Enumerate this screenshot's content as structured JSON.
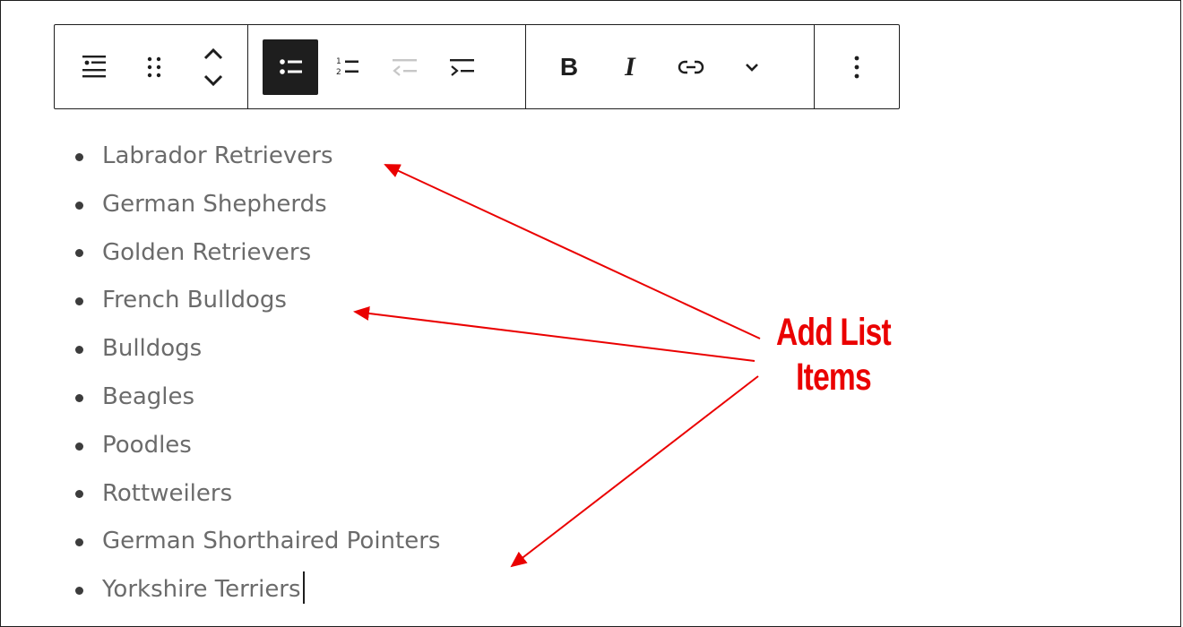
{
  "toolbar": {
    "groups": [
      {
        "name": "block-tools",
        "buttons": [
          {
            "icon": "list-block-icon",
            "active": false
          },
          {
            "icon": "drag-handle-icon",
            "active": false
          },
          {
            "icon": "move-up-down-icon",
            "active": false
          }
        ]
      },
      {
        "name": "list-tools",
        "buttons": [
          {
            "icon": "bulleted-list-icon",
            "active": true
          },
          {
            "icon": "numbered-list-icon",
            "active": false
          },
          {
            "icon": "outdent-icon",
            "active": false,
            "disabled": true
          },
          {
            "icon": "indent-icon",
            "active": false
          }
        ]
      },
      {
        "name": "format-tools",
        "buttons": [
          {
            "icon": "bold-icon",
            "label": "B"
          },
          {
            "icon": "italic-icon",
            "label": "I"
          },
          {
            "icon": "link-icon"
          },
          {
            "icon": "chevron-down-icon"
          }
        ]
      },
      {
        "name": "more-tools",
        "buttons": [
          {
            "icon": "more-vertical-icon"
          }
        ]
      }
    ]
  },
  "list": {
    "items": [
      "Labrador Retrievers",
      "German Shepherds",
      "Golden Retrievers",
      "French Bulldogs",
      "Bulldogs",
      "Beagles",
      "Poodles",
      "Rottweilers",
      "German Shorthaired Pointers",
      "Yorkshire Terriers"
    ]
  },
  "annotation": {
    "line1": "Add List",
    "line2": "Items",
    "color": "#ea0000"
  },
  "colors": {
    "text": "#6b6b6b",
    "toolbar_active_bg": "#1e1e1e",
    "border": "#1e1e1e"
  }
}
